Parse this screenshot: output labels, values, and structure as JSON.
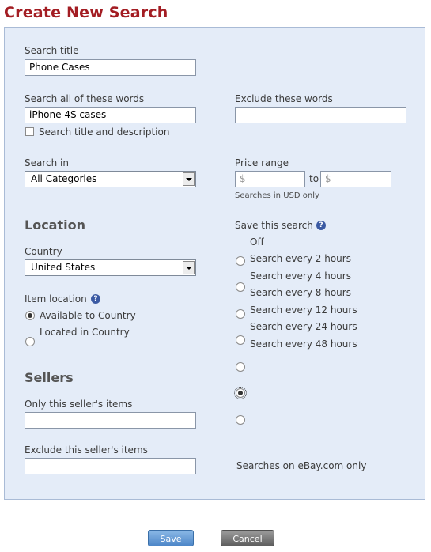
{
  "page": {
    "title": "Create New Search"
  },
  "form": {
    "search_title": {
      "label": "Search title",
      "value": "Phone Cases"
    },
    "all_words": {
      "label": "Search all of these words",
      "value": "iPhone 4S cases"
    },
    "search_desc": {
      "label": "Search title and description",
      "checked": false
    },
    "exclude_words": {
      "label": "Exclude these words",
      "value": ""
    },
    "search_in": {
      "label": "Search in",
      "value": "All Categories"
    },
    "price_range": {
      "label": "Price range",
      "min_placeholder": "$",
      "to_label": "to",
      "max_placeholder": "$",
      "note": "Searches in USD only"
    },
    "location": {
      "heading": "Location",
      "country_label": "Country",
      "country_value": "United States",
      "item_location_label": "Item location",
      "options": [
        {
          "label": "Available to Country",
          "checked": true
        },
        {
          "label": "Located in Country",
          "checked": false
        }
      ]
    },
    "save_search": {
      "label": "Save this search",
      "options": [
        {
          "label": "Off",
          "checked": false
        },
        {
          "label": "Search every 2 hours",
          "checked": false
        },
        {
          "label": "Search every 4 hours",
          "checked": false
        },
        {
          "label": "Search every 8 hours",
          "checked": false
        },
        {
          "label": "Search every 12 hours",
          "checked": false
        },
        {
          "label": "Search every 24 hours",
          "checked": true
        },
        {
          "label": "Search every 48 hours",
          "checked": false
        }
      ]
    },
    "sellers": {
      "heading": "Sellers",
      "only_label": "Only this seller's items",
      "only_value": "",
      "exclude_label": "Exclude this seller's items",
      "exclude_value": "",
      "note": "Searches on eBay.com only"
    }
  },
  "buttons": {
    "save": "Save",
    "cancel": "Cancel"
  },
  "icons": {
    "help": "help-icon",
    "dropdown": "dropdown-arrow-icon"
  },
  "colors": {
    "title": "#a31d23",
    "panel_bg": "#e4ecf8",
    "panel_border": "#a9bbd6"
  }
}
